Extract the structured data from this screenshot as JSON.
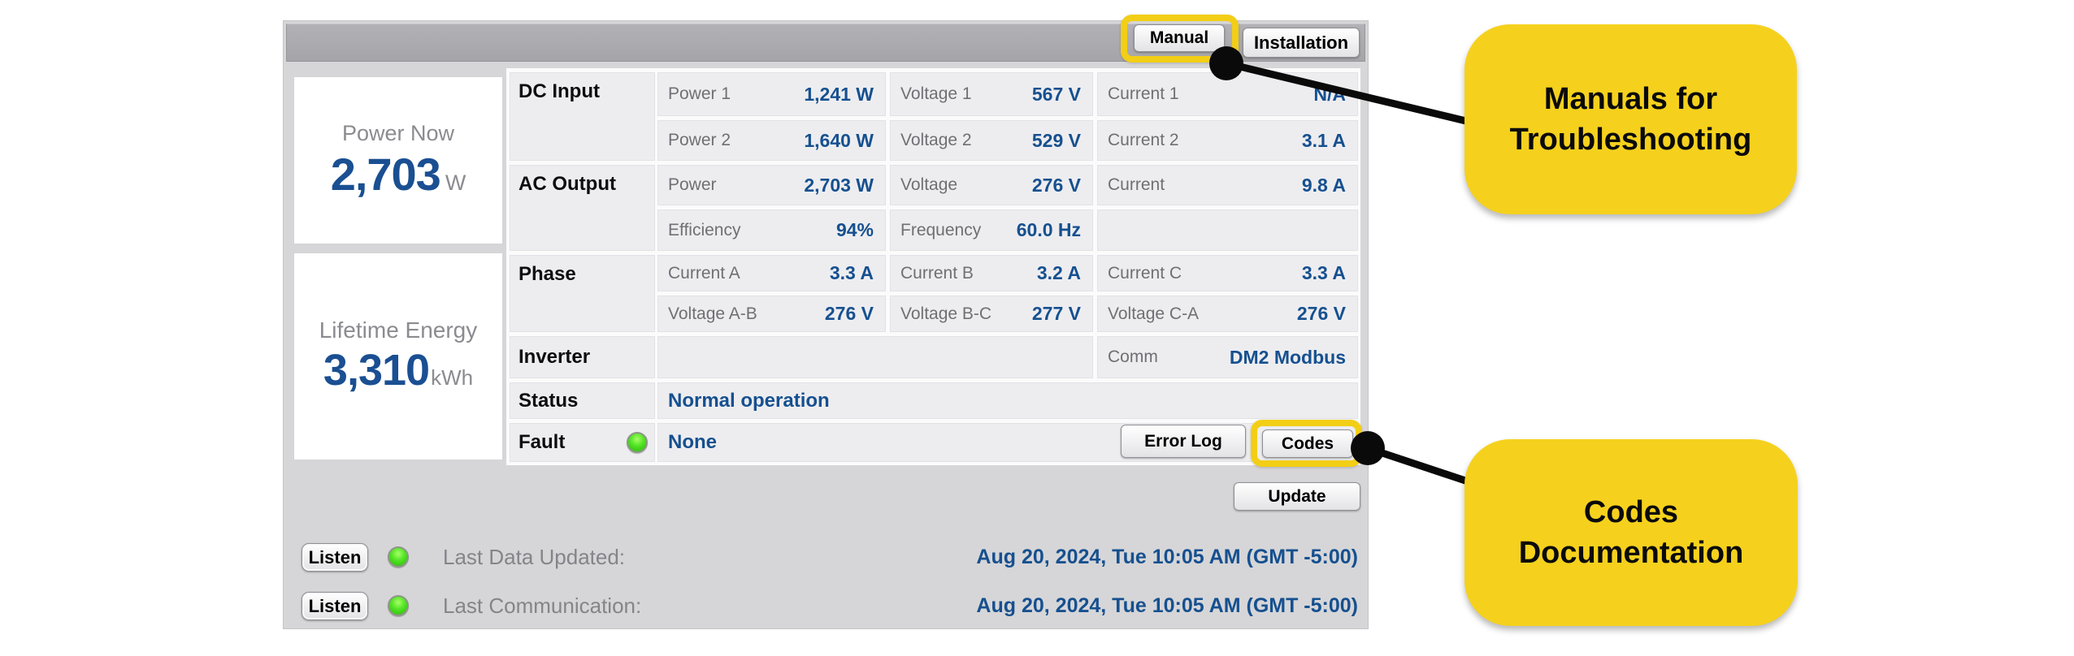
{
  "colors": {
    "highlight_yellow": "#F2CE16",
    "callout_yellow": "#F5D11D",
    "value_blue": "#16508F",
    "led_green": "#43DC20",
    "topbar_gray": "#A9A9AD",
    "widget_gray": "#D6D6D8"
  },
  "toolbar": {
    "manual": "Manual",
    "installation": "Installation"
  },
  "summary": {
    "power_now": {
      "label": "Power Now",
      "value": "2,703",
      "unit": "W"
    },
    "lifetime_energy": {
      "label": "Lifetime Energy",
      "value": "3,310",
      "unit": "kWh"
    }
  },
  "sections": {
    "dc": "DC Input",
    "ac": "AC Output",
    "phase": "Phase",
    "inverter": "Inverter",
    "status": "Status",
    "fault": "Fault"
  },
  "cells": {
    "p1": {
      "label": "Power 1",
      "value": "1,241 W"
    },
    "v1": {
      "label": "Voltage 1",
      "value": "567 V"
    },
    "c1": {
      "label": "Current 1",
      "value": "N/A"
    },
    "p2": {
      "label": "Power 2",
      "value": "1,640 W"
    },
    "v2": {
      "label": "Voltage 2",
      "value": "529 V"
    },
    "c2": {
      "label": "Current 2",
      "value": "3.1 A"
    },
    "acp": {
      "label": "Power",
      "value": "2,703 W"
    },
    "acv": {
      "label": "Voltage",
      "value": "276 V"
    },
    "acc": {
      "label": "Current",
      "value": "9.8 A"
    },
    "eff": {
      "label": "Efficiency",
      "value": "94%"
    },
    "freq": {
      "label": "Frequency",
      "value": "60.0 Hz"
    },
    "ia": {
      "label": "Current A",
      "value": "3.3 A"
    },
    "ib": {
      "label": "Current B",
      "value": "3.2 A"
    },
    "ic": {
      "label": "Current C",
      "value": "3.3 A"
    },
    "vab": {
      "label": "Voltage A-B",
      "value": "276 V"
    },
    "vbc": {
      "label": "Voltage B-C",
      "value": "277 V"
    },
    "vca": {
      "label": "Voltage C-A",
      "value": "276 V"
    },
    "comm": {
      "label": "Comm",
      "value": "DM2 Modbus"
    }
  },
  "status_value": "Normal operation",
  "fault_value": "None",
  "buttons": {
    "error_log": "Error Log",
    "codes": "Codes",
    "update": "Update",
    "listen": "Listen"
  },
  "footer": {
    "rows": [
      {
        "label": "Last Data Updated:",
        "value": "Aug 20, 2024, Tue 10:05 AM (GMT -5:00)"
      },
      {
        "label": "Last Communication:",
        "value": "Aug 20, 2024, Tue 10:05 AM (GMT -5:00)"
      }
    ]
  },
  "annotations": {
    "manual_note": "Manuals for\nTroubleshooting",
    "codes_note": "Codes\nDocumentation"
  }
}
